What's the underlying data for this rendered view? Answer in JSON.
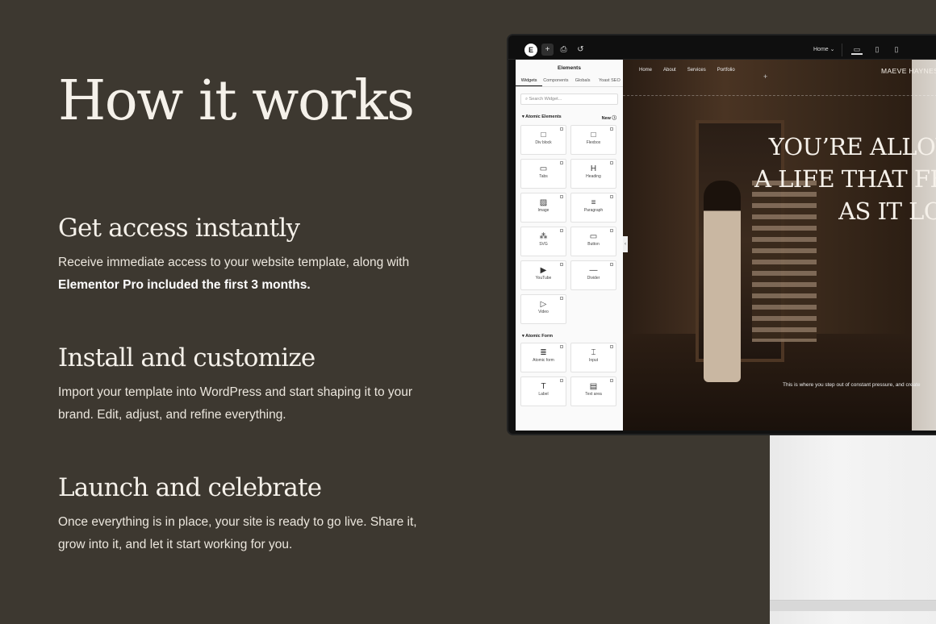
{
  "title": "How it works",
  "steps": [
    {
      "heading": "Get access instantly",
      "text": "Receive immediate access to your website template, along with ",
      "bold": "Elementor Pro included the first 3 months."
    },
    {
      "heading": "Install and customize",
      "text": "Import your template into WordPress and start shaping it to your brand. Edit, adjust, and refine everything."
    },
    {
      "heading": "Launch and celebrate",
      "text": "Once everything is in place, your site is ready to go live. Share it, grow into it, and let it start working for you."
    }
  ],
  "editor": {
    "logo": "E",
    "page_select": "Home",
    "panel_title": "Elements",
    "tabs": [
      "Widgets",
      "Components",
      "Globals",
      "Yoast SEO"
    ],
    "search_placeholder": "Search Widget...",
    "section1": "Atomic Elements",
    "new_label": "New",
    "widgets1": [
      {
        "label": "Div block",
        "icon": "□"
      },
      {
        "label": "Flexbox",
        "icon": "□"
      },
      {
        "label": "Tabs",
        "icon": "▭"
      },
      {
        "label": "Heading",
        "icon": "H"
      },
      {
        "label": "Image",
        "icon": "▨"
      },
      {
        "label": "Paragraph",
        "icon": "≡"
      },
      {
        "label": "SVG",
        "icon": "⁂"
      },
      {
        "label": "Button",
        "icon": "▭"
      },
      {
        "label": "YouTube",
        "icon": "▶"
      },
      {
        "label": "Divider",
        "icon": "—"
      },
      {
        "label": "Video",
        "icon": "▷"
      }
    ],
    "section2": "Atomic Form",
    "widgets2": [
      {
        "label": "Atomic form",
        "icon": "≣"
      },
      {
        "label": "Input",
        "icon": "⌶"
      },
      {
        "label": "Label",
        "icon": "T"
      },
      {
        "label": "Text area",
        "icon": "▤"
      }
    ]
  },
  "site": {
    "nav": [
      "Home",
      "About",
      "Services",
      "Portfolio"
    ],
    "brand": "MAEVE HAYNES",
    "hero_lines": [
      "YOU’RE ALLOWED",
      "A LIFE THAT FEELS",
      "AS IT LOOKS"
    ],
    "hero_sub": "This is where you step out of constant pressure, and create"
  }
}
